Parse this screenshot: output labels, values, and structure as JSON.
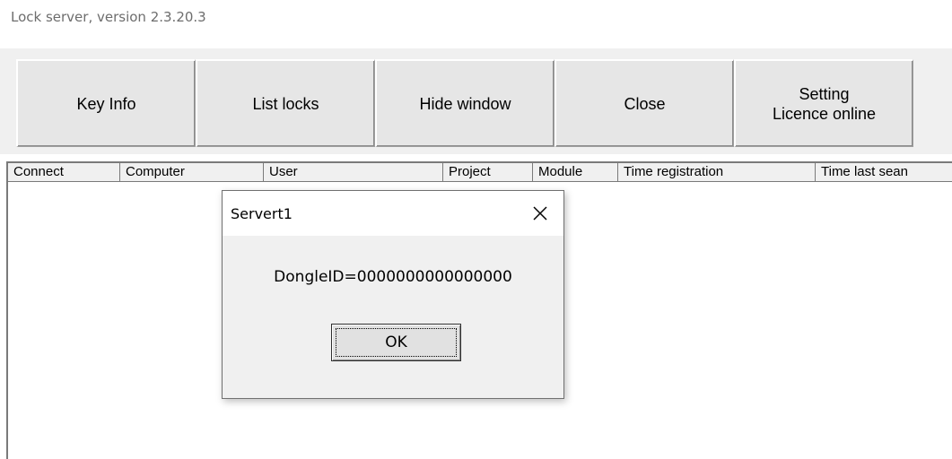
{
  "window": {
    "title": "Lock server, version 2.3.20.3"
  },
  "toolbar": {
    "key_info": "Key Info",
    "list_locks": "List locks",
    "hide_window": "Hide window",
    "close": "Close",
    "setting_line1": "Setting",
    "setting_line2": "Licence online"
  },
  "list": {
    "columns": [
      "Connect",
      "Computer",
      "User",
      "Project",
      "Module",
      "Time registration",
      "Time last sean"
    ]
  },
  "dialog": {
    "title": "Servert1",
    "message": "DongleID=0000000000000000",
    "ok_label": "OK",
    "close_icon": "close-icon"
  }
}
